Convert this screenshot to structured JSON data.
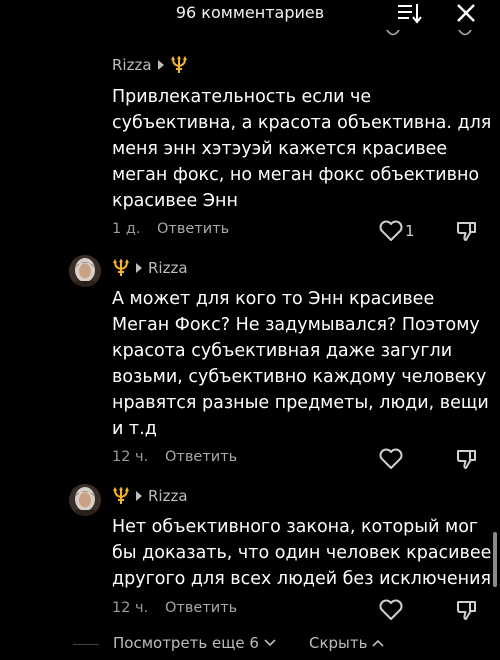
{
  "header": {
    "title": "96 комментариев"
  },
  "comments": [
    {
      "author": "Rizza",
      "text": "Привлекательность если че субъективна, а красота объективна. для меня энн хэтэуэй кажется красивее меган фокс, но меган фокс объективно красивее Энн",
      "time": "1 д.",
      "reply_label": "Ответить",
      "likes": "1"
    },
    {
      "author": "Rizza",
      "text": "А может для кого то Энн красивее Меган Фокс? Не задумывался? Поэтому красота субъективная даже загугли возьми, субъективно каждому человеку нравятся разные предметы, люди, вещи и т.д",
      "time": "12 ч.",
      "reply_label": "Ответить"
    },
    {
      "author": "Rizza",
      "text": "Нет объективного закона, который мог бы доказать, что один человек красивее другого для всех людей без исключения",
      "time": "12 ч.",
      "reply_label": "Ответить"
    }
  ],
  "footer": {
    "view_more_label": "Посмотреть еще 6",
    "hide_label": "Скрыть"
  },
  "colors": {
    "background": "#000000",
    "trident": "#f2b233",
    "muted_text": "#9a9a9a"
  }
}
